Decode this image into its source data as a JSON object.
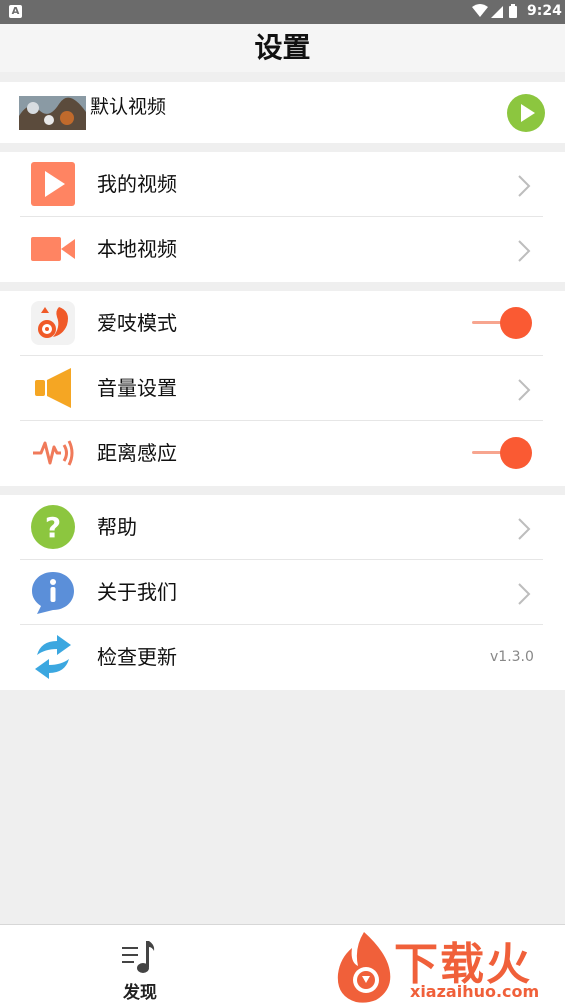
{
  "status_bar": {
    "notification_glyph": "A",
    "time": "9:24"
  },
  "header": {
    "title": "设置"
  },
  "default_video": {
    "label": "默认视频"
  },
  "section_media": {
    "items": [
      {
        "label": "我的视频",
        "icon": "play-square-icon"
      },
      {
        "label": "本地视频",
        "icon": "video-camera-icon"
      }
    ]
  },
  "section_settings": {
    "items": [
      {
        "label": "爱吱模式",
        "icon": "squirrel-icon",
        "toggle_on": true
      },
      {
        "label": "音量设置",
        "icon": "speaker-icon"
      },
      {
        "label": "距离感应",
        "icon": "proximity-sensor-icon",
        "toggle_on": true
      }
    ]
  },
  "section_about": {
    "items": [
      {
        "label": "帮助",
        "icon": "help-icon"
      },
      {
        "label": "关于我们",
        "icon": "info-icon"
      },
      {
        "label": "检查更新",
        "icon": "refresh-icon",
        "version": "v1.3.0"
      }
    ]
  },
  "bottom_nav": {
    "tab_label": "发现"
  },
  "watermark": {
    "brand": "下载火",
    "domain": "xiazaihuo.com"
  },
  "colors": {
    "accent_orange": "#fa5a33",
    "play_green": "#8cc63f",
    "help_green": "#8cc63f",
    "info_blue": "#5b8fd9",
    "speaker_yellow": "#f5a623"
  }
}
